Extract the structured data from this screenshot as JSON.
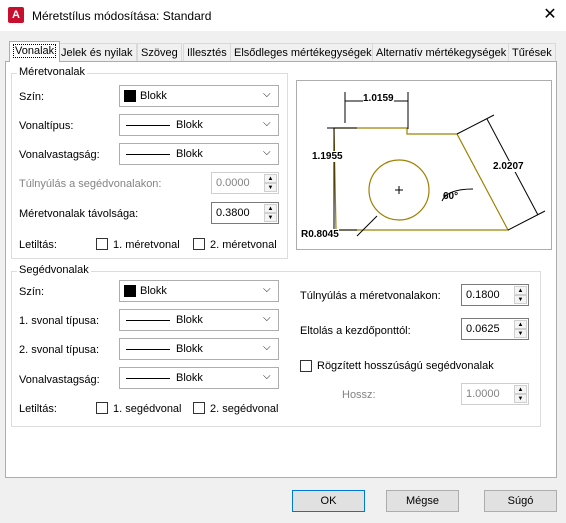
{
  "window": {
    "title": "Méretstílus módosítása: Standard",
    "app_icon": "A",
    "close_glyph": "✕"
  },
  "tabs": [
    "Vonalak",
    "Jelek és nyilak",
    "Szöveg",
    "Illesztés",
    "Elsődleges mértékegységek",
    "Alternatív mértékegységek",
    "Tűrések"
  ],
  "dim_lines": {
    "legend": "Méretvonalak",
    "color_label": "Szín:",
    "color_value": "Blokk",
    "linetype_label": "Vonaltípus:",
    "linetype_value": "Blokk",
    "lineweight_label": "Vonalvastagság:",
    "lineweight_value": "Blokk",
    "extend_label": "Túlnyúlás a segédvonalakon:",
    "extend_value": "0.0000",
    "baseline_label": "Méretvonalak távolsága:",
    "baseline_value": "0.3800",
    "suppress_label": "Letiltás:",
    "suppress_1": "1. méretvonal",
    "suppress_2": "2. méretvonal"
  },
  "ext_lines": {
    "legend": "Segédvonalak",
    "color_label": "Szín:",
    "color_value": "Blokk",
    "lt1_label": "1. svonal típusa:",
    "lt1_value": "Blokk",
    "lt2_label": "2. svonal típusa:",
    "lt2_value": "Blokk",
    "lineweight_label": "Vonalvastagság:",
    "lineweight_value": "Blokk",
    "suppress_label": "Letiltás:",
    "suppress_1": "1. segédvonal",
    "suppress_2": "2. segédvonal",
    "extend_label": "Túlnyúlás a méretvonalakon:",
    "extend_value": "0.1800",
    "offset_label": "Eltolás a kezdőponttól:",
    "offset_value": "0.0625",
    "fixed_label": "Rögzített hosszúságú segédvonalak",
    "length_label": "Hossz:",
    "length_value": "1.0000"
  },
  "preview": {
    "dim_top": "1.0159",
    "dim_left": "1.1955",
    "dim_right": "2.0207",
    "angle": "60°",
    "radius": "R0.8045",
    "shape_color": "#a08000"
  },
  "buttons": {
    "ok": "OK",
    "cancel": "Mégse",
    "help": "Súgó"
  }
}
